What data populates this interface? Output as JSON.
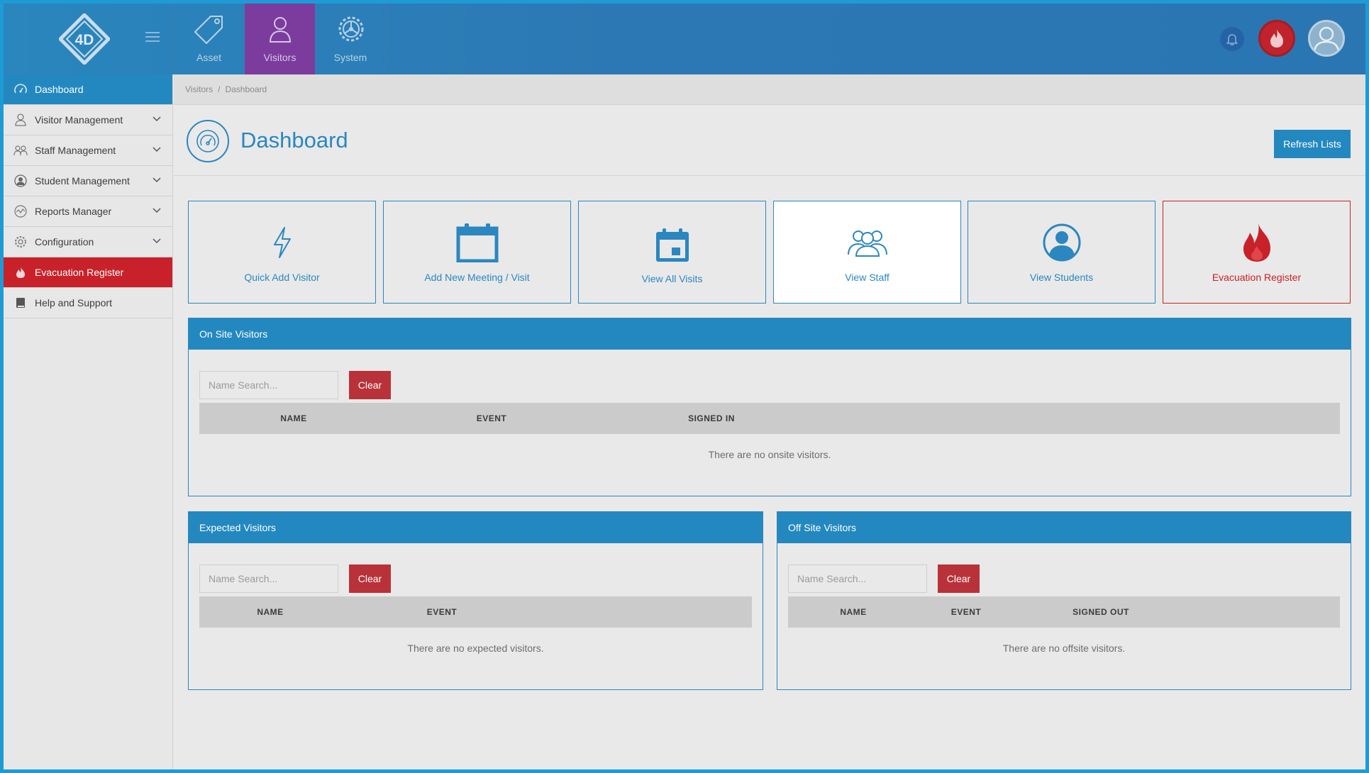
{
  "app": {
    "logo_text": "4D",
    "modules": [
      {
        "label": "Asset",
        "icon": "tag-icon"
      },
      {
        "label": "Visitors",
        "icon": "person-icon"
      },
      {
        "label": "System",
        "icon": "gear-icon"
      }
    ],
    "accent_color": "#2388bf",
    "active_module_color": "#7b3c9e",
    "alert_color": "#c8212a"
  },
  "sidebar": {
    "items": [
      {
        "label": "Dashboard",
        "icon": "dashboard-gauge-icon",
        "active": true
      },
      {
        "label": "Visitor Management",
        "icon": "person-icon",
        "expandable": true
      },
      {
        "label": "Staff Management",
        "icon": "group-icon",
        "expandable": true
      },
      {
        "label": "Student Management",
        "icon": "student-icon",
        "expandable": true
      },
      {
        "label": "Reports Manager",
        "icon": "chart-icon",
        "expandable": true
      },
      {
        "label": "Configuration",
        "icon": "gear-icon",
        "expandable": true
      },
      {
        "label": "Evacuation Register",
        "icon": "fire-icon",
        "alert": true
      },
      {
        "label": "Help and Support",
        "icon": "book-icon"
      }
    ]
  },
  "breadcrumb": {
    "items": [
      "Visitors",
      "Dashboard"
    ],
    "separator": "/"
  },
  "header": {
    "title": "Dashboard",
    "refresh_label": "Refresh Lists"
  },
  "tiles": [
    {
      "label": "Quick Add Visitor",
      "icon": "lightning-icon"
    },
    {
      "label": "Add New Meeting / Visit",
      "icon": "calendar-icon"
    },
    {
      "label": "View All Visits",
      "icon": "calendar-day-icon"
    },
    {
      "label": "View Staff",
      "icon": "group-icon",
      "highlighted": true
    },
    {
      "label": "View Students",
      "icon": "student-icon"
    },
    {
      "label": "Evacuation Register",
      "icon": "fire-icon",
      "alert": true
    }
  ],
  "panels": {
    "onsite": {
      "title": "On Site Visitors",
      "search_placeholder": "Name Search...",
      "clear_label": "Clear",
      "columns": [
        "NAME",
        "EVENT",
        "SIGNED IN"
      ],
      "empty_message": "There are no onsite visitors."
    },
    "expected": {
      "title": "Expected Visitors",
      "search_placeholder": "Name Search...",
      "clear_label": "Clear",
      "columns": [
        "NAME",
        "EVENT"
      ],
      "empty_message": "There are no expected visitors."
    },
    "offsite": {
      "title": "Off Site Visitors",
      "search_placeholder": "Name Search...",
      "clear_label": "Clear",
      "columns": [
        "NAME",
        "EVENT",
        "SIGNED OUT"
      ],
      "empty_message": "There are no offsite visitors."
    }
  }
}
